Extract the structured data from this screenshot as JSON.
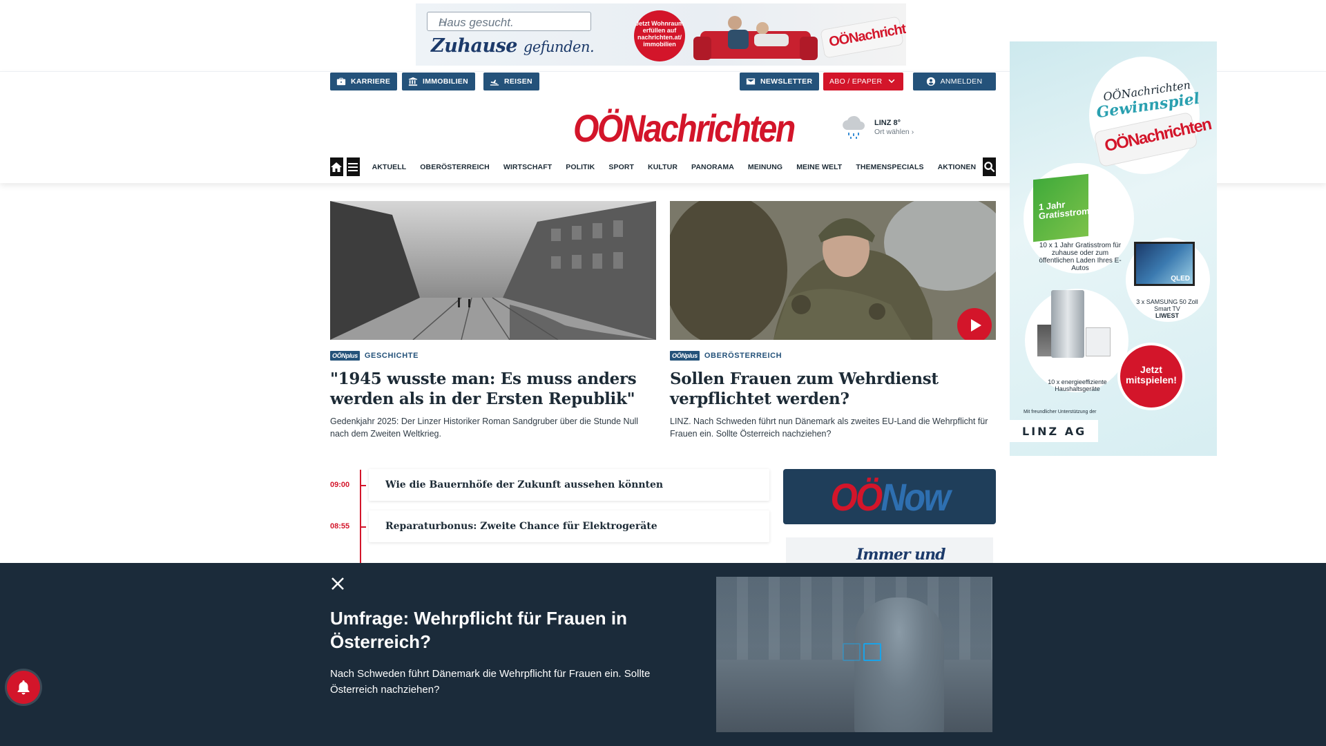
{
  "top_ad": {
    "search_text": "Haus gesucht.",
    "slogan_main": "Zuhause",
    "slogan_tail": "gefunden.",
    "badge_text": "Jetzt Wohnraum erfüllen auf nachrichten.at/ immobilien",
    "logo_text": "OÖNachrichten"
  },
  "header": {
    "util_left": [
      {
        "label": "KARRIERE",
        "icon": "briefcase-icon"
      },
      {
        "label": "IMMOBILIEN",
        "icon": "building-icon"
      },
      {
        "label": "REISEN",
        "icon": "plane-icon"
      }
    ],
    "util_right": [
      {
        "label": "NEWSLETTER",
        "icon": "mail-icon"
      },
      {
        "label": "ABO / EPAPER",
        "icon": "chevron-down-icon"
      },
      {
        "label": "ANMELDEN",
        "icon": "user-icon"
      }
    ],
    "logo": "OÖNachrichten",
    "weather": {
      "city": "LINZ 8°",
      "pick": "Ort wählen",
      "icon": "rain-cloud-icon"
    }
  },
  "nav": {
    "items": [
      "AKTUELL",
      "OBERÖSTERREICH",
      "WIRTSCHAFT",
      "POLITIK",
      "SPORT",
      "KULTUR",
      "PANORAMA",
      "MEINUNG",
      "MEINE WELT",
      "THEMENSPECIALS",
      "AKTIONEN"
    ]
  },
  "teasers": [
    {
      "badge": "OÖNplus",
      "category": "GESCHICHTE",
      "title": "\"1945 wusste man: Es muss anders werden als in der Ersten Republik\"",
      "summary": "Gedenkjahr 2025: Der Linzer Historiker Roman Sandgruber über die Stunde Null nach dem Zweiten Weltkrieg."
    },
    {
      "badge": "OÖNplus",
      "category": "OBERÖSTERREICH",
      "title": "Sollen Frauen zum Wehrdienst verpflichtet werden?",
      "summary": "LINZ. Nach Schweden führt nun Dänemark als zweites EU-Land die Wehrpflicht für Frauen ein. Sollte Österreich nachziehen?"
    }
  ],
  "ticker": [
    {
      "time": "09:00",
      "title": "Wie die Bauernhöfe der Zukunft aussehen könnten"
    },
    {
      "time": "08:55",
      "title": "Reparaturbonus: Zweite Chance für Elektrogeräte"
    }
  ],
  "widgets": {
    "oenow_a": "OÖ",
    "oenow_b": "Now",
    "immer": "Immer und überall."
  },
  "side_ad": {
    "title_1": "OÖNachrichten",
    "title_2": "Gewinnspiel",
    "roll_logo": "OÖNachrichten",
    "box_text": "1 Jahr Gratisstrom",
    "prize_1": "10 x 1 Jahr Gratisstrom für zuhause oder zum öffentlichen Laden Ihres E-Autos",
    "prize_2": "3 x SAMSUNG 50 Zoll Smart TV",
    "prize_2_brand": "LIWEST",
    "tv_label": "QLED",
    "prize_3": "10 x energieeffiziente Haushaltsgeräte",
    "cta": "Jetzt mitspielen!",
    "footer": "Mit freundlicher Unterstützung der",
    "sponsor": "LINZ AG"
  },
  "overlay": {
    "title": "Umfrage: Wehrpflicht für Frauen in Österreich?",
    "text": "Nach Schweden führt Dänemark die Wehrpflicht für Frauen ein. Sollte Österreich nachziehen?"
  },
  "colors": {
    "brand_red": "#d3152a",
    "brand_blue": "#24527a",
    "overlay_bg": "#1b2b3a"
  }
}
